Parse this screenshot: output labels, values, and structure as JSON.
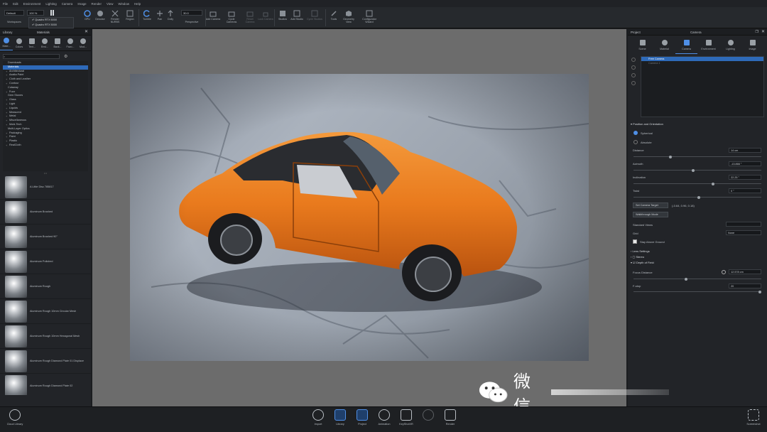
{
  "menu": [
    "File",
    "Edit",
    "Environment",
    "Lighting",
    "Camera",
    "Image",
    "Render",
    "View",
    "Window",
    "Help"
  ],
  "toolbar": {
    "workspace_value": "Default",
    "workspace_label": "Workspaces",
    "zoom_value": "100 %",
    "gpu_options": [
      "Quadro RTX 6000",
      "Quadro RTX 5000"
    ],
    "gpu_label": "GPU",
    "buttons": [
      "Denoise",
      "Render NURBS",
      "Region",
      "Tumble",
      "Pan",
      "Dolly"
    ],
    "fov_value": "30.0",
    "perspective_label": "Perspective",
    "camera_buttons": [
      "Add Camera",
      "Cycle Cameras",
      "Reset Camera",
      "Lock Camera"
    ],
    "studio_buttons": [
      "Studios",
      "Add Studio",
      "Cycle Studios"
    ],
    "right_buttons": [
      "Tools",
      "Geometry View",
      "Configurator Wizard"
    ]
  },
  "left": {
    "header_library": "Library",
    "header_materials": "Materials",
    "tabs": [
      "Mate...",
      "Colors",
      "Text...",
      "Envi...",
      "Back...",
      "Favo...",
      "Mod..."
    ],
    "tree": [
      {
        "label": "Downloads",
        "plus": false
      },
      {
        "label": "Materials",
        "plus": false,
        "selected": true
      },
      {
        "label": "Architectural",
        "plus": true
      },
      {
        "label": "Axalta Paint",
        "plus": true
      },
      {
        "label": "Cloth and Leather",
        "plus": true
      },
      {
        "label": "Contour",
        "plus": true
      },
      {
        "label": "Cutaway",
        "plus": false
      },
      {
        "label": "Fuzz",
        "plus": true
      },
      {
        "label": "Gem Stones",
        "plus": false
      },
      {
        "label": "Glass",
        "plus": true
      },
      {
        "label": "Light",
        "plus": true
      },
      {
        "label": "Liquids",
        "plus": true
      },
      {
        "label": "Measured",
        "plus": true
      },
      {
        "label": "Metal",
        "plus": true
      },
      {
        "label": "Miscellaneous",
        "plus": true
      },
      {
        "label": "Mold-Tech",
        "plus": true
      },
      {
        "label": "Multi-Layer Optics",
        "plus": false
      },
      {
        "label": "Packaging",
        "plus": true
      },
      {
        "label": "Paint",
        "plus": true
      },
      {
        "label": "Plastic",
        "plus": true
      },
      {
        "label": "RealCloth",
        "plus": true
      }
    ],
    "materials": [
      "A Little Disc 785817",
      "Aluminum Brushed",
      "Aluminum Brushed 90°",
      "Aluminum Polished",
      "Aluminum Rough",
      "Aluminum Rough 10mm Circular Mesh",
      "Aluminum Rough 10mm Hexagonal Mesh",
      "Aluminum Rough Diamond Plate 01 Displace",
      "Aluminum Rough Diamond Plate 02"
    ]
  },
  "right": {
    "header_project": "Project",
    "header_camera": "Camera",
    "tabs": [
      "Scene",
      "Material",
      "Camera",
      "Environment",
      "Lighting",
      "Image"
    ],
    "camera_list": [
      "Free Camera",
      "Camera 1"
    ],
    "section_position": "Position and Orientation",
    "radio_spherical": "Spherical",
    "radio_absolute": "Absolute",
    "distance_label": "Distance",
    "distance_value": "14 cm",
    "azimuth_label": "Azimuth",
    "azimuth_value": "-13.866 °",
    "inclination_label": "Inclination",
    "inclination_value": "22.25 °",
    "twist_label": "Twist",
    "twist_value": "0 °",
    "set_target_label": "Set Camera Target",
    "target_coords": "(-0.64, 0.96, 0.18)",
    "walkthrough_label": "Walkthrough Mode",
    "standard_views_label": "Standard Views",
    "grid_label": "Grid",
    "grid_value": "None",
    "stay_above_label": "Stay Above Ground",
    "lens_settings": "Lens Settings",
    "stereo": "Stereo",
    "dof": "Depth of Field",
    "focus_label": "Focus Distance",
    "focus_value": "12.578 cm",
    "fstop_label": "F-stop",
    "fstop_value": "20"
  },
  "bottom": {
    "cloud_library": "Cloud Library",
    "buttons": [
      "Import",
      "Library",
      "Project",
      "Animation",
      "KeyShotXR",
      "",
      "Render"
    ],
    "screenshot": "Screenshot"
  },
  "watermark": "微信"
}
